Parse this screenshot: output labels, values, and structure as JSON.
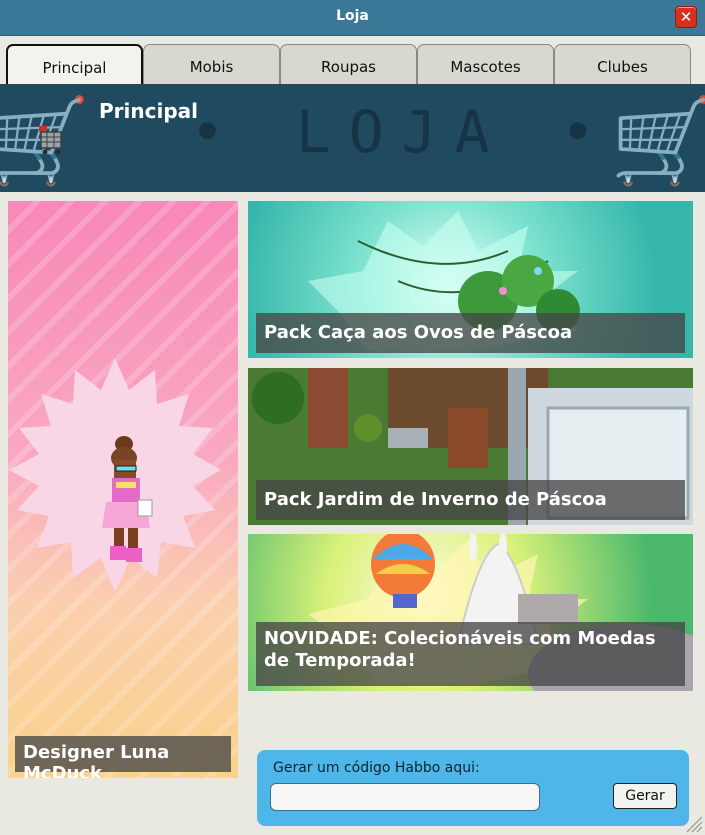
{
  "window": {
    "title": "Loja",
    "close_label": "✕"
  },
  "tabs": [
    {
      "label": "Principal",
      "active": true
    },
    {
      "label": "Mobis",
      "active": false
    },
    {
      "label": "Roupas",
      "active": false
    },
    {
      "label": "Mascotes",
      "active": false
    },
    {
      "label": "Clubes",
      "active": false
    }
  ],
  "header": {
    "heading": "Principal",
    "watermark": "• LOJA •",
    "icon": "shopping-cart-icon"
  },
  "promos": {
    "featured": {
      "caption": "Designer Luna McDuck"
    },
    "banners": [
      {
        "caption": "Pack Caça aos Ovos de Páscoa"
      },
      {
        "caption": "Pack Jardim de Inverno de Páscoa"
      },
      {
        "caption": "NOVIDADE: Colecionáveis com Moedas de Temporada!"
      }
    ]
  },
  "code_panel": {
    "label": "Gerar um código Habbo aqui:",
    "input_value": "",
    "button_label": "Gerar"
  },
  "colors": {
    "titlebar": "#3b7898",
    "header": "#1f4a60",
    "code_panel": "#4fb6ea",
    "close_button": "#d8301f"
  }
}
